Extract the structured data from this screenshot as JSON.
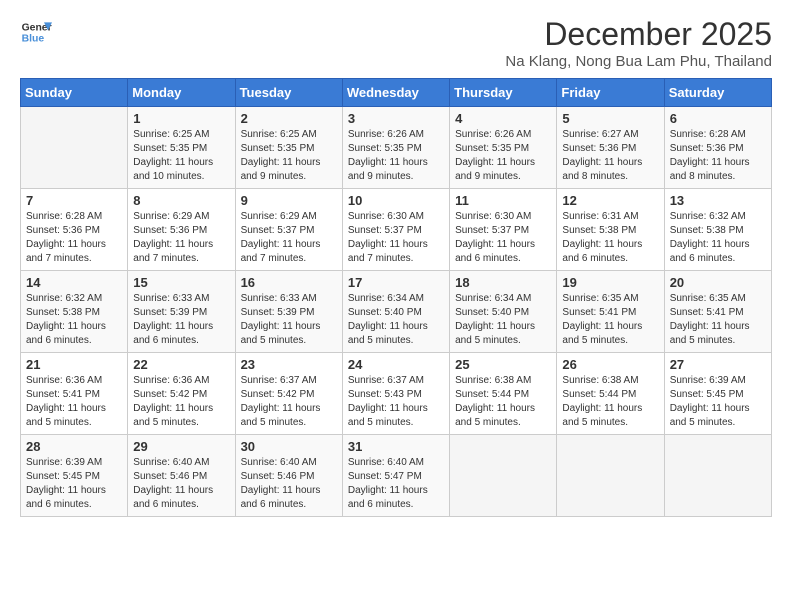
{
  "logo": {
    "line1": "General",
    "line2": "Blue"
  },
  "title": "December 2025",
  "location": "Na Klang, Nong Bua Lam Phu, Thailand",
  "days_of_week": [
    "Sunday",
    "Monday",
    "Tuesday",
    "Wednesday",
    "Thursday",
    "Friday",
    "Saturday"
  ],
  "weeks": [
    [
      {
        "day": "",
        "empty": true
      },
      {
        "day": "1",
        "sunrise": "6:25 AM",
        "sunset": "5:35 PM",
        "daylight": "11 hours and 10 minutes."
      },
      {
        "day": "2",
        "sunrise": "6:25 AM",
        "sunset": "5:35 PM",
        "daylight": "11 hours and 9 minutes."
      },
      {
        "day": "3",
        "sunrise": "6:26 AM",
        "sunset": "5:35 PM",
        "daylight": "11 hours and 9 minutes."
      },
      {
        "day": "4",
        "sunrise": "6:26 AM",
        "sunset": "5:35 PM",
        "daylight": "11 hours and 9 minutes."
      },
      {
        "day": "5",
        "sunrise": "6:27 AM",
        "sunset": "5:36 PM",
        "daylight": "11 hours and 8 minutes."
      },
      {
        "day": "6",
        "sunrise": "6:28 AM",
        "sunset": "5:36 PM",
        "daylight": "11 hours and 8 minutes."
      }
    ],
    [
      {
        "day": "7",
        "sunrise": "6:28 AM",
        "sunset": "5:36 PM",
        "daylight": "11 hours and 7 minutes."
      },
      {
        "day": "8",
        "sunrise": "6:29 AM",
        "sunset": "5:36 PM",
        "daylight": "11 hours and 7 minutes."
      },
      {
        "day": "9",
        "sunrise": "6:29 AM",
        "sunset": "5:37 PM",
        "daylight": "11 hours and 7 minutes."
      },
      {
        "day": "10",
        "sunrise": "6:30 AM",
        "sunset": "5:37 PM",
        "daylight": "11 hours and 7 minutes."
      },
      {
        "day": "11",
        "sunrise": "6:30 AM",
        "sunset": "5:37 PM",
        "daylight": "11 hours and 6 minutes."
      },
      {
        "day": "12",
        "sunrise": "6:31 AM",
        "sunset": "5:38 PM",
        "daylight": "11 hours and 6 minutes."
      },
      {
        "day": "13",
        "sunrise": "6:32 AM",
        "sunset": "5:38 PM",
        "daylight": "11 hours and 6 minutes."
      }
    ],
    [
      {
        "day": "14",
        "sunrise": "6:32 AM",
        "sunset": "5:38 PM",
        "daylight": "11 hours and 6 minutes."
      },
      {
        "day": "15",
        "sunrise": "6:33 AM",
        "sunset": "5:39 PM",
        "daylight": "11 hours and 6 minutes."
      },
      {
        "day": "16",
        "sunrise": "6:33 AM",
        "sunset": "5:39 PM",
        "daylight": "11 hours and 5 minutes."
      },
      {
        "day": "17",
        "sunrise": "6:34 AM",
        "sunset": "5:40 PM",
        "daylight": "11 hours and 5 minutes."
      },
      {
        "day": "18",
        "sunrise": "6:34 AM",
        "sunset": "5:40 PM",
        "daylight": "11 hours and 5 minutes."
      },
      {
        "day": "19",
        "sunrise": "6:35 AM",
        "sunset": "5:41 PM",
        "daylight": "11 hours and 5 minutes."
      },
      {
        "day": "20",
        "sunrise": "6:35 AM",
        "sunset": "5:41 PM",
        "daylight": "11 hours and 5 minutes."
      }
    ],
    [
      {
        "day": "21",
        "sunrise": "6:36 AM",
        "sunset": "5:41 PM",
        "daylight": "11 hours and 5 minutes."
      },
      {
        "day": "22",
        "sunrise": "6:36 AM",
        "sunset": "5:42 PM",
        "daylight": "11 hours and 5 minutes."
      },
      {
        "day": "23",
        "sunrise": "6:37 AM",
        "sunset": "5:42 PM",
        "daylight": "11 hours and 5 minutes."
      },
      {
        "day": "24",
        "sunrise": "6:37 AM",
        "sunset": "5:43 PM",
        "daylight": "11 hours and 5 minutes."
      },
      {
        "day": "25",
        "sunrise": "6:38 AM",
        "sunset": "5:44 PM",
        "daylight": "11 hours and 5 minutes."
      },
      {
        "day": "26",
        "sunrise": "6:38 AM",
        "sunset": "5:44 PM",
        "daylight": "11 hours and 5 minutes."
      },
      {
        "day": "27",
        "sunrise": "6:39 AM",
        "sunset": "5:45 PM",
        "daylight": "11 hours and 5 minutes."
      }
    ],
    [
      {
        "day": "28",
        "sunrise": "6:39 AM",
        "sunset": "5:45 PM",
        "daylight": "11 hours and 6 minutes."
      },
      {
        "day": "29",
        "sunrise": "6:40 AM",
        "sunset": "5:46 PM",
        "daylight": "11 hours and 6 minutes."
      },
      {
        "day": "30",
        "sunrise": "6:40 AM",
        "sunset": "5:46 PM",
        "daylight": "11 hours and 6 minutes."
      },
      {
        "day": "31",
        "sunrise": "6:40 AM",
        "sunset": "5:47 PM",
        "daylight": "11 hours and 6 minutes."
      },
      {
        "day": "",
        "empty": true
      },
      {
        "day": "",
        "empty": true
      },
      {
        "day": "",
        "empty": true
      }
    ]
  ],
  "labels": {
    "sunrise": "Sunrise:",
    "sunset": "Sunset:",
    "daylight": "Daylight:"
  },
  "colors": {
    "header_bg": "#3a7bd5",
    "header_text": "#ffffff"
  }
}
